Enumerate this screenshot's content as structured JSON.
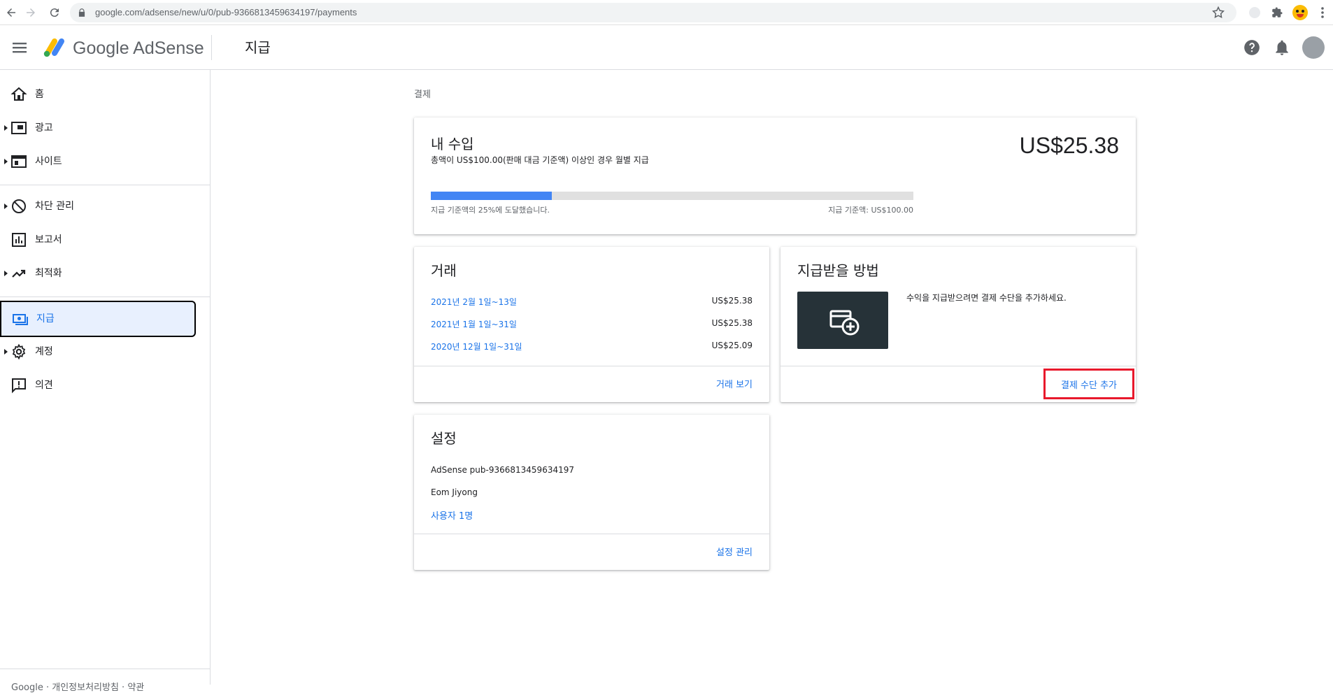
{
  "browser": {
    "url": "google.com/adsense/new/u/0/pub-9366813459634197/payments"
  },
  "app": {
    "brand": "Google AdSense",
    "page_title": "지급"
  },
  "sidebar": {
    "items": [
      {
        "label": "홈",
        "icon": "home-icon"
      },
      {
        "label": "광고",
        "icon": "ads-icon"
      },
      {
        "label": "사이트",
        "icon": "sites-icon"
      },
      {
        "label": "차단 관리",
        "icon": "block-icon"
      },
      {
        "label": "보고서",
        "icon": "reports-icon"
      },
      {
        "label": "최적화",
        "icon": "trending-icon"
      },
      {
        "label": "지급",
        "icon": "payments-icon"
      },
      {
        "label": "계정",
        "icon": "settings-icon"
      },
      {
        "label": "의견",
        "icon": "feedback-icon"
      }
    ],
    "footer": "Google · 개인정보처리방침 · 약관"
  },
  "breadcrumb": "결제",
  "earnings": {
    "title": "내 수입",
    "subtitle": "총액이 US$100.00(판매 대금 기준액) 이상인 경우 월별 지급",
    "amount": "US$25.38",
    "progress_percent": 25,
    "progress_label": "지급 기준액의 25%에 도달했습니다.",
    "threshold_label": "지급 기준액: US$100.00"
  },
  "transactions": {
    "title": "거래",
    "rows": [
      {
        "date": "2021년 2월 1일~13일",
        "amount": "US$25.38"
      },
      {
        "date": "2021년 1월 1일~31일",
        "amount": "US$25.38"
      },
      {
        "date": "2020년 12월 1일~31일",
        "amount": "US$25.09"
      }
    ],
    "view_link": "거래 보기"
  },
  "payment_method": {
    "title": "지급받을 방법",
    "description": "수익을 지급받으려면 결제 수단을 추가하세요.",
    "add_button": "결제 수단 추가"
  },
  "settings": {
    "title": "설정",
    "publisher": "AdSense pub-9366813459634197",
    "name": "Eom Jiyong",
    "users_link": "사용자 1명",
    "manage_link": "설정 관리"
  },
  "colors": {
    "accent": "#1a73e8",
    "progress": "#4285f4",
    "highlight": "#e8192c",
    "dark_tile": "#263238"
  }
}
